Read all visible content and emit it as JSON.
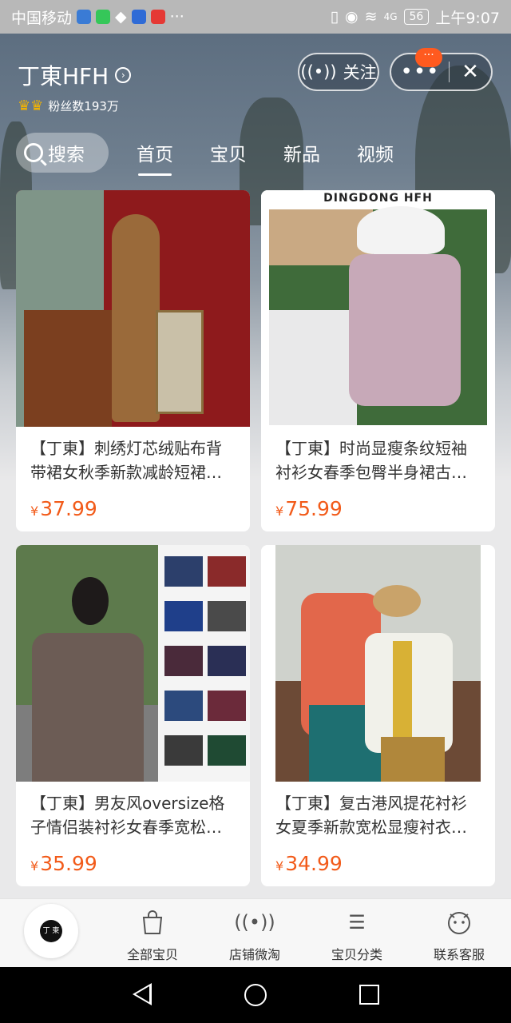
{
  "status_bar": {
    "carrier": "中国移动",
    "time": "上午9:07",
    "battery": "56",
    "signal_label": "4G"
  },
  "shop": {
    "name": "丁東HFH",
    "fans_label": "粉丝数193万",
    "follow_label": "关注",
    "more_badge": "···"
  },
  "tabs": {
    "search": "搜索",
    "items": [
      "首页",
      "宝贝",
      "新品",
      "视频"
    ]
  },
  "products": [
    {
      "name": "【丁東】刺绣灯芯绒贴布背带裙女秋季新款减龄短裙…",
      "currency": "¥",
      "price": "37.99"
    },
    {
      "name": "【丁東】时尚显瘦条纹短袖衬衫女春季包臀半身裙古…",
      "currency": "¥",
      "price": "75.99",
      "image_caption": "DINGDONG HFH"
    },
    {
      "name": "【丁東】男友风oversize格子情侣装衬衫女春季宽松…",
      "currency": "¥",
      "price": "35.99"
    },
    {
      "name": "【丁東】复古港风提花衬衫女夏季新款宽松显瘦衬衣…",
      "currency": "¥",
      "price": "34.99"
    }
  ],
  "bottom_nav": {
    "logo_text": "丁 東",
    "items": [
      {
        "label": "全部宝贝",
        "icon": "shopping-bag-icon"
      },
      {
        "label": "店铺微淘",
        "icon": "broadcast-icon"
      },
      {
        "label": "宝贝分类",
        "icon": "list-icon"
      },
      {
        "label": "联系客服",
        "icon": "chat-face-icon"
      }
    ]
  },
  "colors": {
    "price": "#f25b1a",
    "badge": "#ff5a1f"
  }
}
